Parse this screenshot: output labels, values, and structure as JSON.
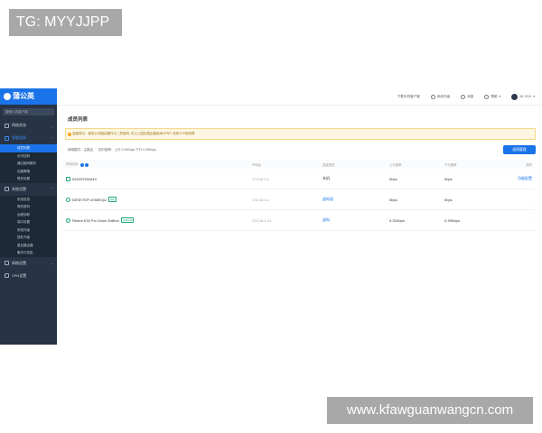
{
  "watermark_top": "TG: MYYJJPP",
  "watermark_bottom": "www.kfawguanwangcn.com",
  "sidebar": {
    "brand": "蒲公英",
    "search_placeholder": "搜索人员客户端",
    "groups": [
      {
        "label": "网络状态"
      },
      {
        "label": "智能组网",
        "active": true,
        "items": [
          "成员列表",
          "访问控制",
          "通过组网服务",
          "加速策略",
          "联安设置"
        ]
      },
      {
        "label": "系统设置",
        "items": [
          "系统信息",
          "修改密码",
          "远程协助",
          "端口设置",
          "系统升级",
          "插件升级",
          "重启路由器",
          "备份与恢复"
        ]
      },
      {
        "label": "网络设置"
      },
      {
        "label": "VPN设置"
      }
    ]
  },
  "topbar": {
    "download": "下载手机客户端",
    "sysmsg": "系统升级",
    "notice": "消息",
    "help": "帮助",
    "user": "A1 2111"
  },
  "main": {
    "title": "成员列表",
    "banner": "温馨提示：使用公司路由器作为二层组网, 在以上园区路由器使用UPNP, 请用TCP组网等",
    "info": {
      "mode": "网络模式：主路由",
      "speed": "实时速率：上行 0.32Kbps 下行 0.39Kbps"
    },
    "button": "组网管理",
    "columns": [
      "终端名称",
      "IP地址",
      "连接类型",
      "上行速率",
      "下行速率",
      "操作"
    ],
    "rows": [
      {
        "name": "526337591649",
        "tag": "",
        "ip": "172.16.1.1",
        "type": "本机",
        "up": "0bps",
        "down": "0bps",
        "action": "功能配置"
      },
      {
        "name": "DESKTOP-8760EQU",
        "tag": "Win",
        "ip": "172.16.1.x",
        "type": "虚拟组",
        "up": "0bps",
        "down": "0bps",
        "action": "-"
      },
      {
        "name": "Redmi K30 Pro Zoom Edition",
        "tag": "Android",
        "ip": "172.16.1.14",
        "type": "虚拟",
        "up": "0.32Kbps",
        "down": "0.39Kbps",
        "action": "-"
      }
    ]
  }
}
